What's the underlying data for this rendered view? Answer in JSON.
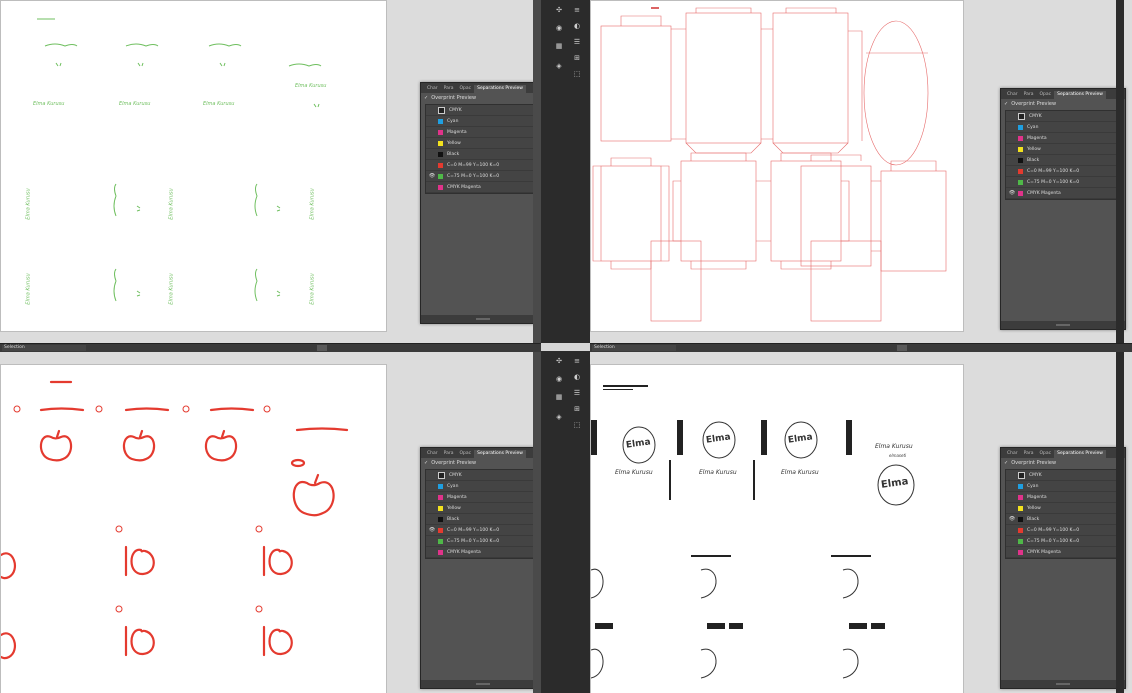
{
  "panel": {
    "tabs": [
      "Char",
      "Para",
      "Opac",
      "Separations Preview"
    ],
    "overprint_check": "✓",
    "overprint_label": "Overprint Preview",
    "rows": [
      {
        "label": "CMYK",
        "swatch": "#2a2a2a",
        "kind": "cmyk"
      },
      {
        "label": "Cyan",
        "swatch": "#1f9fe0"
      },
      {
        "label": "Magenta",
        "swatch": "#e0338a"
      },
      {
        "label": "Yellow",
        "swatch": "#f3e21e"
      },
      {
        "label": "Black",
        "swatch": "#111111"
      },
      {
        "label": "C=0 M=99 Y=100 K=0",
        "swatch": "#e43a2f"
      },
      {
        "label": "C=75 M=0 Y=100 K=0",
        "swatch": "#4fb848"
      },
      {
        "label": "CMYK Magenta",
        "swatch": "#e0338a"
      }
    ]
  },
  "status_bar": {
    "selection_label": "Selection"
  },
  "brand": {
    "name": "Elma Kurusu",
    "logo": "Elma",
    "tagline": "elmaseti"
  },
  "colors": {
    "green": "#6fbf5f",
    "red": "#e43a2f",
    "dieline": "#e66a6a"
  }
}
